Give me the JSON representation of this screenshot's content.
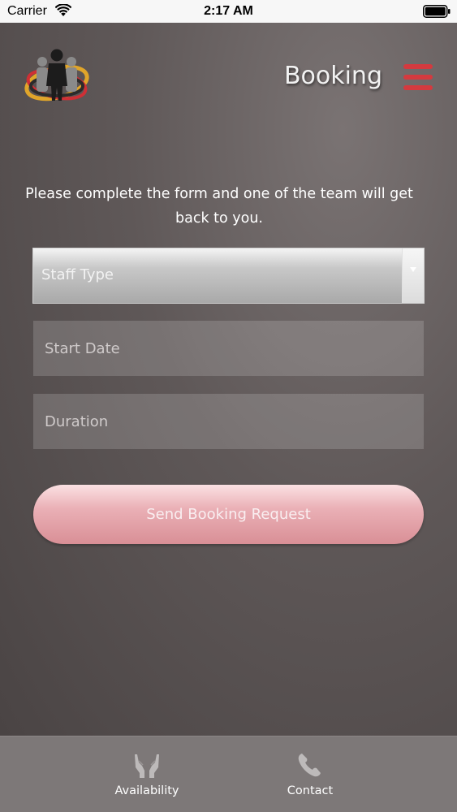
{
  "status_bar": {
    "carrier": "Carrier",
    "time": "2:17 AM"
  },
  "header": {
    "title": "Booking"
  },
  "form": {
    "intro_text": "Please complete the form and one of the team will get back to you.",
    "staff_type": {
      "placeholder": "Staff Type"
    },
    "start_date": {
      "placeholder": "Start Date",
      "value": ""
    },
    "duration": {
      "placeholder": "Duration",
      "value": ""
    },
    "submit_label": "Send Booking Request"
  },
  "tabs": [
    {
      "label": "Availability",
      "icon": "open-hands-icon"
    },
    {
      "label": "Contact",
      "icon": "phone-icon"
    }
  ],
  "colors": {
    "accent": "#d43a3f",
    "button_pink": "#eab0b6",
    "tab_bar": "#7d7878"
  }
}
